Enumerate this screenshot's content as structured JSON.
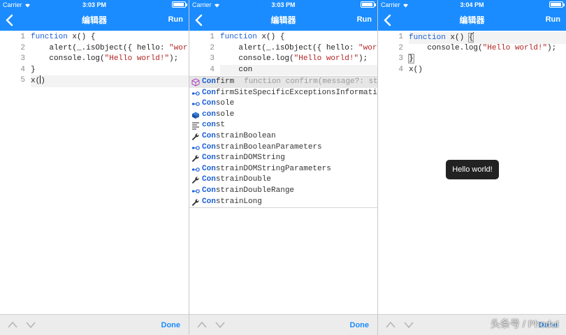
{
  "colors": {
    "accent": "#1a8cff",
    "keyword": "#1a5fd6",
    "string": "#b22424",
    "toast_bg": "#222222"
  },
  "icons": {
    "back": "chevron-left-icon",
    "wifi": "wifi-icon",
    "battery": "battery-icon",
    "up": "chevron-up-icon",
    "down": "chevron-down-icon",
    "method": "cube-icon",
    "property": "dot-link-icon",
    "snippet": "lines-icon",
    "wrench": "wrench-icon",
    "object": "box-icon"
  },
  "panels": [
    {
      "status": {
        "carrier": "Carrier",
        "time": "3:03 PM"
      },
      "nav": {
        "title": "编辑器",
        "run": "Run"
      },
      "toolbar": {
        "done": "Done"
      },
      "lines": [
        {
          "no": "1",
          "kw": "function",
          "rest": " x() {"
        },
        {
          "no": "2",
          "pre": "    alert(_.isObject({ hello: ",
          "str": "\"world\"",
          "post": " }));"
        },
        {
          "no": "3",
          "pre": "    console.log(",
          "str": "\"Hello world!\"",
          "post": ");"
        },
        {
          "no": "4",
          "text": "}"
        },
        {
          "no": "5",
          "a": "x(",
          "b": ")"
        }
      ]
    },
    {
      "status": {
        "carrier": "Carrier",
        "time": "3:03 PM"
      },
      "nav": {
        "title": "编辑器",
        "run": "Run"
      },
      "toolbar": {
        "done": "Done"
      },
      "lines": [
        {
          "no": "1",
          "kw": "function",
          "rest": " x() {"
        },
        {
          "no": "2",
          "pre": "    alert(_.isObject({ hello: ",
          "str": "\"world\"",
          "post": " }));"
        },
        {
          "no": "3",
          "pre": "    console.log(",
          "str": "\"Hello world!\"",
          "post": ");"
        },
        {
          "no": "4",
          "text": "    con"
        }
      ],
      "autocomplete": [
        {
          "match": "Con",
          "rest": "firm",
          "detail": "function confirm(message?: string): boolean"
        },
        {
          "match": "Con",
          "rest": "firmSiteSpecificExceptionsInformation"
        },
        {
          "match": "Con",
          "rest": "sole"
        },
        {
          "match": "con",
          "rest": "sole"
        },
        {
          "match": "con",
          "rest": "st"
        },
        {
          "match": "Con",
          "rest": "strainBoolean"
        },
        {
          "match": "Con",
          "rest": "strainBooleanParameters"
        },
        {
          "match": "Con",
          "rest": "strainDOMString"
        },
        {
          "match": "Con",
          "rest": "strainDOMStringParameters"
        },
        {
          "match": "Con",
          "rest": "strainDouble"
        },
        {
          "match": "Con",
          "rest": "strainDoubleRange"
        },
        {
          "match": "Con",
          "rest": "strainLong"
        }
      ]
    },
    {
      "status": {
        "carrier": "Carrier",
        "time": "3:04 PM"
      },
      "nav": {
        "title": "编辑器",
        "run": "Run"
      },
      "toolbar": {
        "done": "Done"
      },
      "lines": [
        {
          "no": "1",
          "kw": "function",
          "rest": " x() ",
          "brace": "{"
        },
        {
          "no": "2",
          "pre": "    console.log(",
          "str": "\"Hello world!\"",
          "post": ");"
        },
        {
          "no": "3",
          "brace": "}"
        },
        {
          "no": "4",
          "text": "x()"
        }
      ],
      "toast": "Hello world!",
      "watermark": "头条号 / PhoduI"
    }
  ]
}
